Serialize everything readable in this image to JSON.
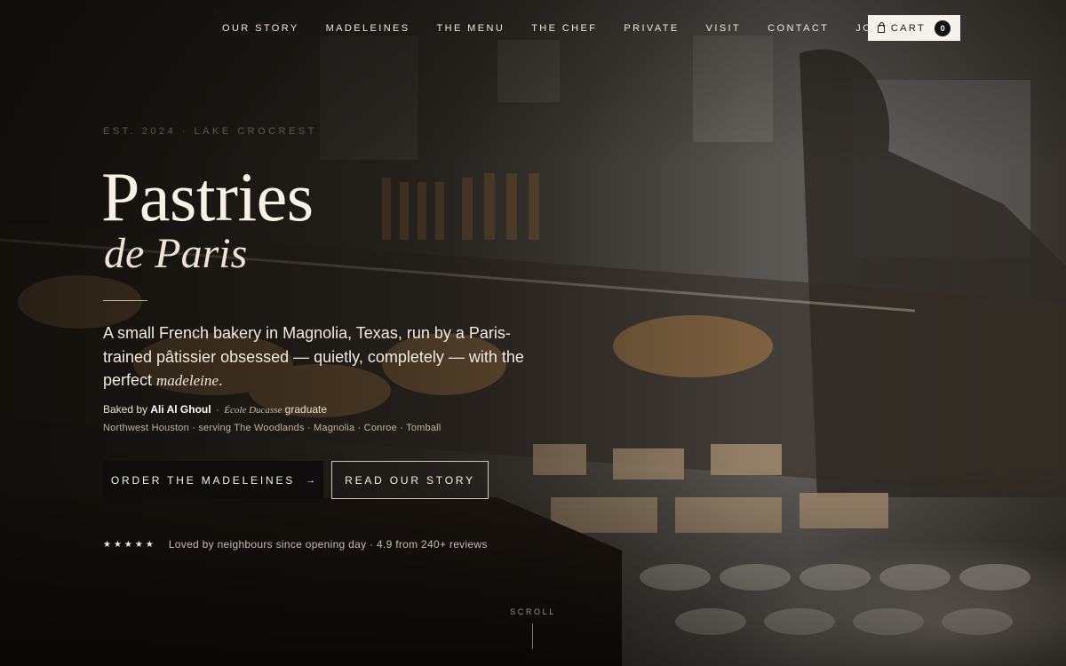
{
  "nav": {
    "links": [
      "OUR STORY",
      "MADELEINES",
      "THE MENU",
      "THE CHEF",
      "PRIVATE",
      "VISIT",
      "CONTACT",
      "JOURNAL"
    ],
    "cart_label": "CART",
    "cart_count": "0",
    "cart_icon": "bag-icon"
  },
  "hero": {
    "eyebrow": "EST. 2024 · LAKE CROCREST",
    "title": "Pastries",
    "subtitle": "de Paris",
    "lede_main": "A small French bakery in Magnolia, Texas, run by a Paris-trained pâtissier obsessed — quietly, completely — with the perfect ",
    "lede_em": "madeleine",
    "lede_end": ".",
    "baked_prefix": "Baked by ",
    "chef_name": "Ali Al Ghoul",
    "baked_sep": "·",
    "school": "École Ducasse",
    "baked_suffix": " graduate",
    "areas": "Northwest Houston · serving The Woodlands · Magnolia · Conroe · Tomball",
    "primary_cta": "ORDER THE MADELEINES",
    "primary_cta_arrow": "→",
    "secondary_cta": "READ OUR STORY",
    "stars": "★★★★★",
    "rating_text": "Loved by neighbours since opening day · 4.9 from 240+ reviews",
    "scroll_label": "SCROLL"
  },
  "colors": {
    "background": "#0d0b09",
    "text": "#f3ece2",
    "cart_bg": "#f6f1ea",
    "primary_btn_bg": "#0f0d0b"
  }
}
